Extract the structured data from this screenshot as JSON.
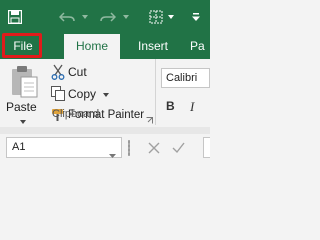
{
  "qat": {
    "save_icon": "save-icon",
    "undo_icon": "undo-icon",
    "redo_icon": "redo-icon",
    "more_icon": "customize-qat-icon"
  },
  "tabs": {
    "file": "File",
    "home": "Home",
    "insert": "Insert",
    "page_layout_partial": "Pa"
  },
  "clipboard": {
    "paste_label": "Paste",
    "cut_label": "Cut",
    "copy_label": "Copy",
    "format_painter_label": "Format Painter",
    "group_label": "Clipboard"
  },
  "font": {
    "font_name": "Calibri",
    "bold_label": "B",
    "italic_label": "I"
  },
  "formula_bar": {
    "name_box_value": "A1"
  },
  "colors": {
    "title_bar": "#217346",
    "highlight": "#e11b1b",
    "ribbon_bg": "#f3f3f3"
  }
}
